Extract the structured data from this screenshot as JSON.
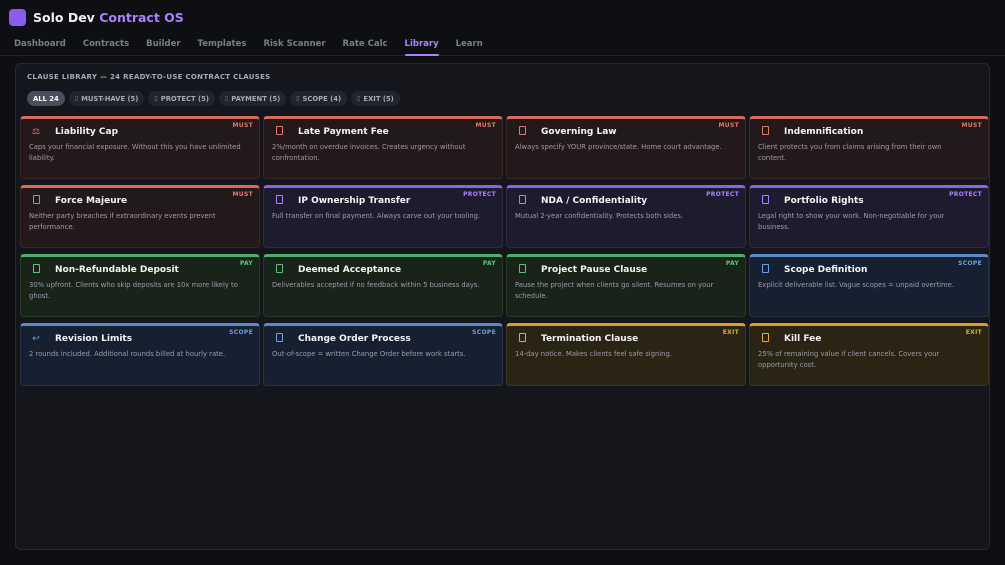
{
  "app": {
    "brand_main": "Solo Dev",
    "brand_accent": "Contract OS",
    "accent_color": "#8a5cf0"
  },
  "nav": {
    "items": [
      "Dashboard",
      "Contracts",
      "Builder",
      "Templates",
      "Risk Scanner",
      "Rate Calc",
      "Library",
      "Learn"
    ],
    "active": "Library"
  },
  "library": {
    "title": "CLAUSE LIBRARY — 24 READY-TO-USE CONTRACT CLAUSES",
    "filters": [
      {
        "label": "ALL 24",
        "active": true,
        "icon": ""
      },
      {
        "label": "MUST-HAVE (5)",
        "active": false,
        "icon": "box-icon"
      },
      {
        "label": "PROTECT (5)",
        "active": false,
        "icon": "box-icon"
      },
      {
        "label": "PAYMENT (5)",
        "active": false,
        "icon": "box-icon"
      },
      {
        "label": "SCOPE (4)",
        "active": false,
        "icon": "box-icon"
      },
      {
        "label": "EXIT (5)",
        "active": false,
        "icon": "box-icon"
      }
    ],
    "clauses": [
      {
        "title": "Liability Cap",
        "tag": "MUST",
        "kind": "must",
        "icon": "scale-icon",
        "glyph": "⚖",
        "desc": "Caps your financial exposure. Without this you have unlimited liability."
      },
      {
        "title": "Late Payment Fee",
        "tag": "MUST",
        "kind": "must",
        "icon": "box-icon",
        "glyph": "",
        "desc": "2%/month on overdue invoices. Creates urgency without confrontation."
      },
      {
        "title": "Governing Law",
        "tag": "MUST",
        "kind": "must",
        "icon": "box-icon",
        "glyph": "",
        "desc": "Always specify YOUR province/state. Home court advantage."
      },
      {
        "title": "Indemnification",
        "tag": "MUST",
        "kind": "must",
        "icon": "box-icon",
        "glyph": "",
        "desc": "Client protects you from claims arising from their own content."
      },
      {
        "title": "Force Majeure",
        "tag": "MUST",
        "kind": "must",
        "icon": "box-icon",
        "glyph": "",
        "desc": "Neither party breaches if extraordinary events prevent performance."
      },
      {
        "title": "IP Ownership Transfer",
        "tag": "PROTECT",
        "kind": "protect",
        "icon": "box-icon",
        "glyph": "",
        "desc": "Full transfer on final payment. Always carve out your tooling."
      },
      {
        "title": "NDA / Confidentiality",
        "tag": "PROTECT",
        "kind": "protect",
        "icon": "box-icon",
        "glyph": "",
        "desc": "Mutual 2-year confidentiality. Protects both sides."
      },
      {
        "title": "Portfolio Rights",
        "tag": "PROTECT",
        "kind": "protect",
        "icon": "box-icon",
        "glyph": "",
        "desc": "Legal right to show your work. Non-negotiable for your business."
      },
      {
        "title": "Non-Refundable Deposit",
        "tag": "PAY",
        "kind": "pay",
        "icon": "box-icon",
        "glyph": "",
        "desc": "30% upfront. Clients who skip deposits are 10x more likely to ghost."
      },
      {
        "title": "Deemed Acceptance",
        "tag": "PAY",
        "kind": "pay",
        "icon": "box-icon",
        "glyph": "",
        "desc": "Deliverables accepted if no feedback within 5 business days."
      },
      {
        "title": "Project Pause Clause",
        "tag": "PAY",
        "kind": "pay",
        "icon": "box-icon",
        "glyph": "",
        "desc": "Pause the project when clients go silent. Resumes on your schedule."
      },
      {
        "title": "Scope Definition",
        "tag": "SCOPE",
        "kind": "scope",
        "icon": "box-icon",
        "glyph": "",
        "desc": "Explicit deliverable list. Vague scopes = unpaid overtime."
      },
      {
        "title": "Revision Limits",
        "tag": "SCOPE",
        "kind": "scope",
        "icon": "return-arrow-icon",
        "glyph": "↩",
        "desc": "2 rounds included. Additional rounds billed at hourly rate."
      },
      {
        "title": "Change Order Process",
        "tag": "SCOPE",
        "kind": "scope",
        "icon": "box-icon",
        "glyph": "",
        "desc": "Out-of-scope = written Change Order before work starts."
      },
      {
        "title": "Termination Clause",
        "tag": "EXIT",
        "kind": "exit",
        "icon": "box-icon",
        "glyph": "",
        "desc": "14-day notice. Makes clients feel safe signing."
      },
      {
        "title": "Kill Fee",
        "tag": "EXIT",
        "kind": "exit",
        "icon": "box-icon",
        "glyph": "",
        "desc": "25% of remaining value if client cancels. Covers your opportunity cost."
      }
    ]
  }
}
